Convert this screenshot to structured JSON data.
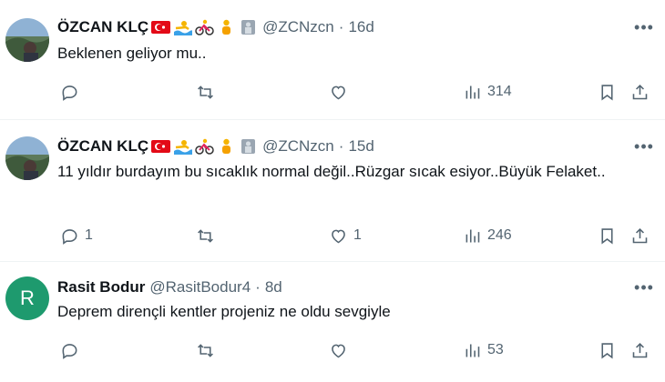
{
  "tweets": [
    {
      "author": "ÖZCAN KLÇ",
      "handle": "@ZCNzcn",
      "separator": "·",
      "time": "16d",
      "avatar_kind": "photo",
      "text": "Beklenen geliyor mu..",
      "stats": {
        "replies": "",
        "retweets": "",
        "likes": "",
        "views": "314"
      }
    },
    {
      "author": "ÖZCAN KLÇ",
      "handle": "@ZCNzcn",
      "separator": "·",
      "time": "15d",
      "avatar_kind": "photo",
      "text": "11 yıldır burdayım bu sıcaklık normal değil..Rüzgar sıcak esiyor..Büyük Felaket..",
      "stats": {
        "replies": "1",
        "retweets": "",
        "likes": "1",
        "views": "246"
      }
    },
    {
      "author": "Rasit Bodur",
      "handle": "@RasitBodur4",
      "separator": "·",
      "time": "8d",
      "avatar_kind": "letter",
      "avatar_letter": "R",
      "avatar_color": "#1e9a6e",
      "text": "Deprem dirençli kentler projeniz ne oldu sevgiyle",
      "stats": {
        "replies": "",
        "retweets": "",
        "likes": "",
        "views": "53"
      }
    }
  ],
  "more_glyph": "•••",
  "name_emojis": [
    "turkey-flag-emoji",
    "swimmer-emoji",
    "cyclist-emoji",
    "person-emoji",
    "statue-emoji"
  ],
  "colors": {
    "text": "#0f1419",
    "muted": "#536471",
    "divider": "#eff3f4",
    "flag_red": "#e30a17"
  }
}
